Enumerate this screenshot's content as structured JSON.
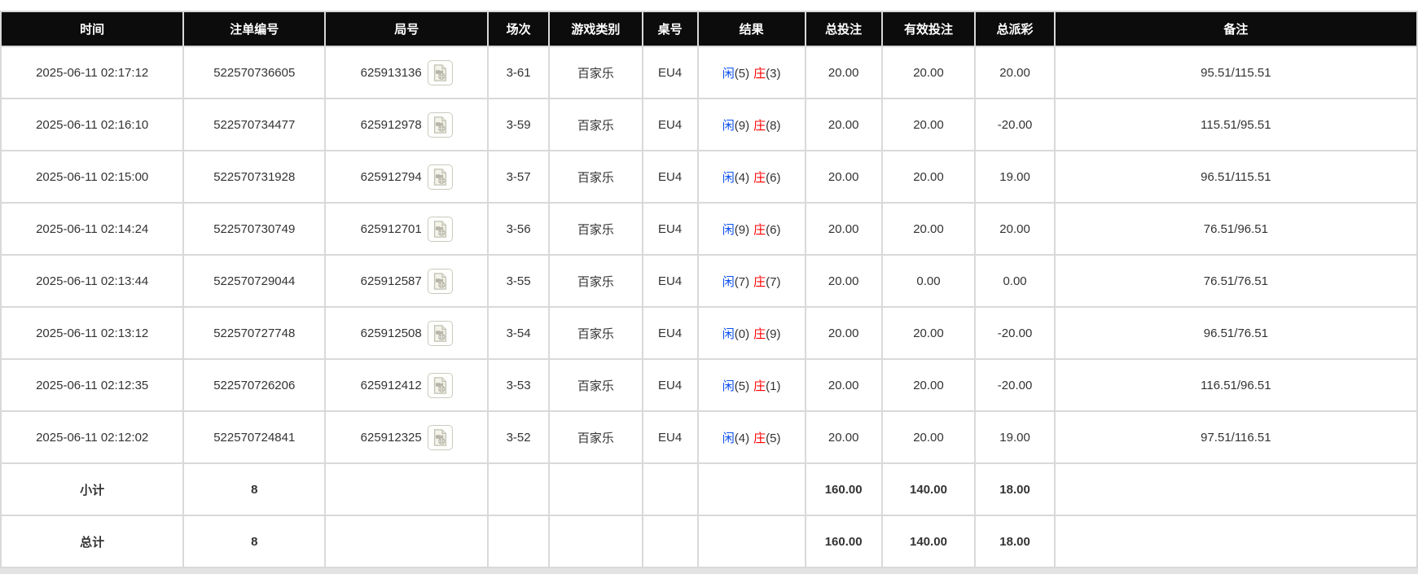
{
  "colors": {
    "header_bg": "#0c0c0c",
    "header_text": "#ffffff",
    "highlight_row_bg": "#fafaa5",
    "row_bg": "#ffffff",
    "summary_row_bg": "#999999",
    "summary_text": "#ffffff",
    "result_player_blue": "#0b50ee",
    "result_banker_red": "#ff0000",
    "amount_blue": "#0b50ee",
    "negative_red": "#ff0000",
    "cell_border": "#d9d9d9",
    "body_text": "#333333"
  },
  "table": {
    "columns": [
      {
        "key": "time",
        "label": "时间"
      },
      {
        "key": "bet_no",
        "label": "注单编号"
      },
      {
        "key": "round_no",
        "label": "局号"
      },
      {
        "key": "session",
        "label": "场次"
      },
      {
        "key": "game_type",
        "label": "游戏类别"
      },
      {
        "key": "table_no",
        "label": "桌号"
      },
      {
        "key": "result",
        "label": "结果"
      },
      {
        "key": "total_bet",
        "label": "总投注"
      },
      {
        "key": "valid_bet",
        "label": "有效投注"
      },
      {
        "key": "total_payout",
        "label": "总派彩"
      },
      {
        "key": "remark",
        "label": "备注"
      }
    ],
    "rows": [
      {
        "time": "2025-06-11 02:17:12",
        "bet_no": "522570736605",
        "round_no": "625913136",
        "session": "3-61",
        "game_type": "百家乐",
        "table_no": "EU4",
        "result": {
          "player_label": "闲",
          "player_score": "(5)",
          "banker_label": "庄",
          "banker_score": "(3)"
        },
        "total_bet": "20.00",
        "valid_bet": "20.00",
        "total_payout": "20.00",
        "remark": "95.51/115.51",
        "highlighted": true
      },
      {
        "time": "2025-06-11 02:16:10",
        "bet_no": "522570734477",
        "round_no": "625912978",
        "session": "3-59",
        "game_type": "百家乐",
        "table_no": "EU4",
        "result": {
          "player_label": "闲",
          "player_score": "(9)",
          "banker_label": "庄",
          "banker_score": "(8)"
        },
        "total_bet": "20.00",
        "valid_bet": "20.00",
        "total_payout": "-20.00",
        "remark": "115.51/95.51",
        "highlighted": false
      },
      {
        "time": "2025-06-11 02:15:00",
        "bet_no": "522570731928",
        "round_no": "625912794",
        "session": "3-57",
        "game_type": "百家乐",
        "table_no": "EU4",
        "result": {
          "player_label": "闲",
          "player_score": "(4)",
          "banker_label": "庄",
          "banker_score": "(6)"
        },
        "total_bet": "20.00",
        "valid_bet": "20.00",
        "total_payout": "19.00",
        "remark": "96.51/115.51",
        "highlighted": false
      },
      {
        "time": "2025-06-11 02:14:24",
        "bet_no": "522570730749",
        "round_no": "625912701",
        "session": "3-56",
        "game_type": "百家乐",
        "table_no": "EU4",
        "result": {
          "player_label": "闲",
          "player_score": "(9)",
          "banker_label": "庄",
          "banker_score": "(6)"
        },
        "total_bet": "20.00",
        "valid_bet": "20.00",
        "total_payout": "20.00",
        "remark": "76.51/96.51",
        "highlighted": false
      },
      {
        "time": "2025-06-11 02:13:44",
        "bet_no": "522570729044",
        "round_no": "625912587",
        "session": "3-55",
        "game_type": "百家乐",
        "table_no": "EU4",
        "result": {
          "player_label": "闲",
          "player_score": "(7)",
          "banker_label": "庄",
          "banker_score": "(7)"
        },
        "total_bet": "20.00",
        "valid_bet": "0.00",
        "total_payout": "0.00",
        "remark": "76.51/76.51",
        "highlighted": false
      },
      {
        "time": "2025-06-11 02:13:12",
        "bet_no": "522570727748",
        "round_no": "625912508",
        "session": "3-54",
        "game_type": "百家乐",
        "table_no": "EU4",
        "result": {
          "player_label": "闲",
          "player_score": "(0)",
          "banker_label": "庄",
          "banker_score": "(9)"
        },
        "total_bet": "20.00",
        "valid_bet": "20.00",
        "total_payout": "-20.00",
        "remark": "96.51/76.51",
        "highlighted": false
      },
      {
        "time": "2025-06-11 02:12:35",
        "bet_no": "522570726206",
        "round_no": "625912412",
        "session": "3-53",
        "game_type": "百家乐",
        "table_no": "EU4",
        "result": {
          "player_label": "闲",
          "player_score": "(5)",
          "banker_label": "庄",
          "banker_score": "(1)"
        },
        "total_bet": "20.00",
        "valid_bet": "20.00",
        "total_payout": "-20.00",
        "remark": "116.51/96.51",
        "highlighted": false
      },
      {
        "time": "2025-06-11 02:12:02",
        "bet_no": "522570724841",
        "round_no": "625912325",
        "session": "3-52",
        "game_type": "百家乐",
        "table_no": "EU4",
        "result": {
          "player_label": "闲",
          "player_score": "(4)",
          "banker_label": "庄",
          "banker_score": "(5)"
        },
        "total_bet": "20.00",
        "valid_bet": "20.00",
        "total_payout": "19.00",
        "remark": "97.51/116.51",
        "highlighted": false
      }
    ],
    "subtotal": {
      "label": "小计",
      "count": "8",
      "total_bet": "160.00",
      "valid_bet": "140.00",
      "total_payout": "18.00"
    },
    "total": {
      "label": "总计",
      "count": "8",
      "total_bet": "160.00",
      "valid_bet": "140.00",
      "total_payout": "18.00"
    }
  },
  "icons": {
    "video_replay": "video-replay-icon"
  }
}
